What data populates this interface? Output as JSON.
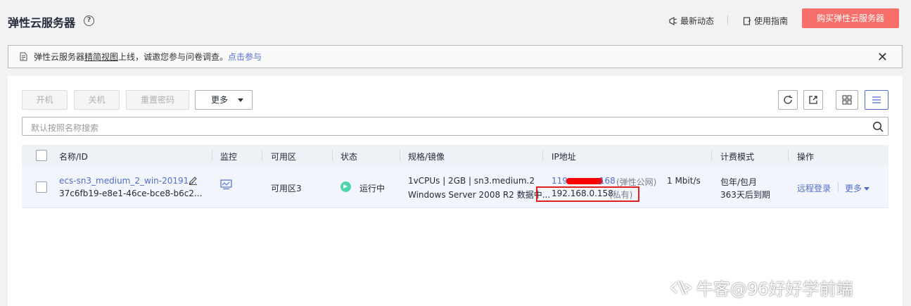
{
  "header": {
    "title": "弹性云服务器",
    "help_icon": "?",
    "news_label": "最新动态",
    "guide_label": "使用指南",
    "buy_label": "购买弹性云服务器"
  },
  "notice": {
    "prefix": "弹性云服务器",
    "underlined": "精简视图",
    "suffix": "上线，诚邀您参与问卷调查。",
    "link": "点击参与",
    "close": "✕"
  },
  "toolbar": {
    "start": "开机",
    "stop": "关机",
    "reset_password": "重置密码",
    "more": "更多"
  },
  "search": {
    "placeholder": "默认按照名称搜索"
  },
  "table": {
    "headers": [
      "名称/ID",
      "监控",
      "可用区",
      "状态",
      "规格/镜像",
      "IP地址",
      "计费模式",
      "操作"
    ],
    "row": {
      "name": "ecs-sn3_medium_2_win-20191...",
      "id": "37c6fb19-e8e1-46ce-bce8-b6c2...",
      "zone": "可用区3",
      "status": "运行中",
      "spec": "1vCPUs | 2GB | sn3.medium.2",
      "image": "Windows Server 2008 R2 数据中...",
      "public_ip_start": "119",
      "public_ip_end": ".168",
      "public_tag": "(弹性公网)",
      "bandwidth": "1 Mbit/s",
      "private_ip": "192.168.0.158",
      "private_tag": "(私有)",
      "billing": "包年/包月",
      "expiry": "363天后到期",
      "remote_login": "远程登录",
      "more": "更多"
    }
  },
  "watermark": {
    "text": "牛客@96好好学前端"
  },
  "colors": {
    "primary": "#526ecc",
    "buy_button": "#f66f6a",
    "running": "#50d4ab",
    "highlight": "#e02020"
  }
}
